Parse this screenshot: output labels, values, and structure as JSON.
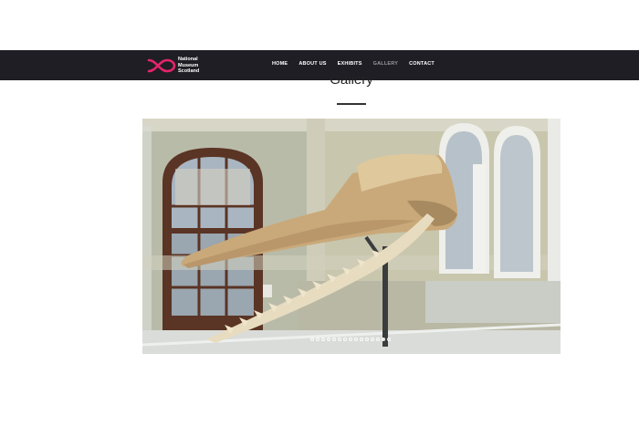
{
  "brand": {
    "line1": "National",
    "line2": "Museum",
    "line3": "Scotland",
    "accent_color": "#e4246b"
  },
  "nav": {
    "items": [
      {
        "label": "HOME"
      },
      {
        "label": "ABOUT US"
      },
      {
        "label": "EXHIBITS"
      },
      {
        "label": "GALLERY",
        "active": true
      },
      {
        "label": "CONTACT"
      }
    ]
  },
  "page": {
    "title": "Gallery"
  },
  "slider": {
    "image_subject": "whale skeleton",
    "dot_count": 15,
    "active_index": 13
  }
}
